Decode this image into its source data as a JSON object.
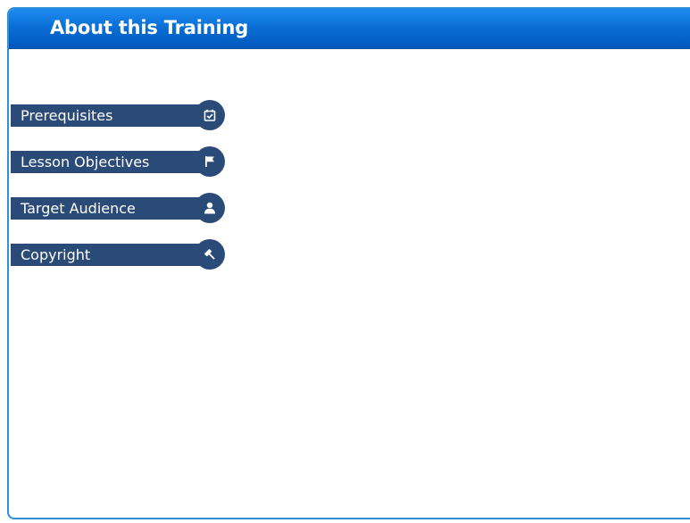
{
  "header": {
    "title": "About this Training"
  },
  "menu": {
    "items": [
      {
        "label": "Prerequisites",
        "icon": "calendar-check-icon"
      },
      {
        "label": "Lesson Objectives",
        "icon": "flag-icon"
      },
      {
        "label": "Target Audience",
        "icon": "user-icon"
      },
      {
        "label": "Copyright",
        "icon": "gavel-icon"
      }
    ]
  },
  "colors": {
    "header_gradient_top": "#1f8cf0",
    "header_gradient_bottom": "#0057be",
    "frame_border": "#2f8fd8",
    "menu_item_bg": "#2a4a78",
    "menu_text": "#ffffff"
  }
}
